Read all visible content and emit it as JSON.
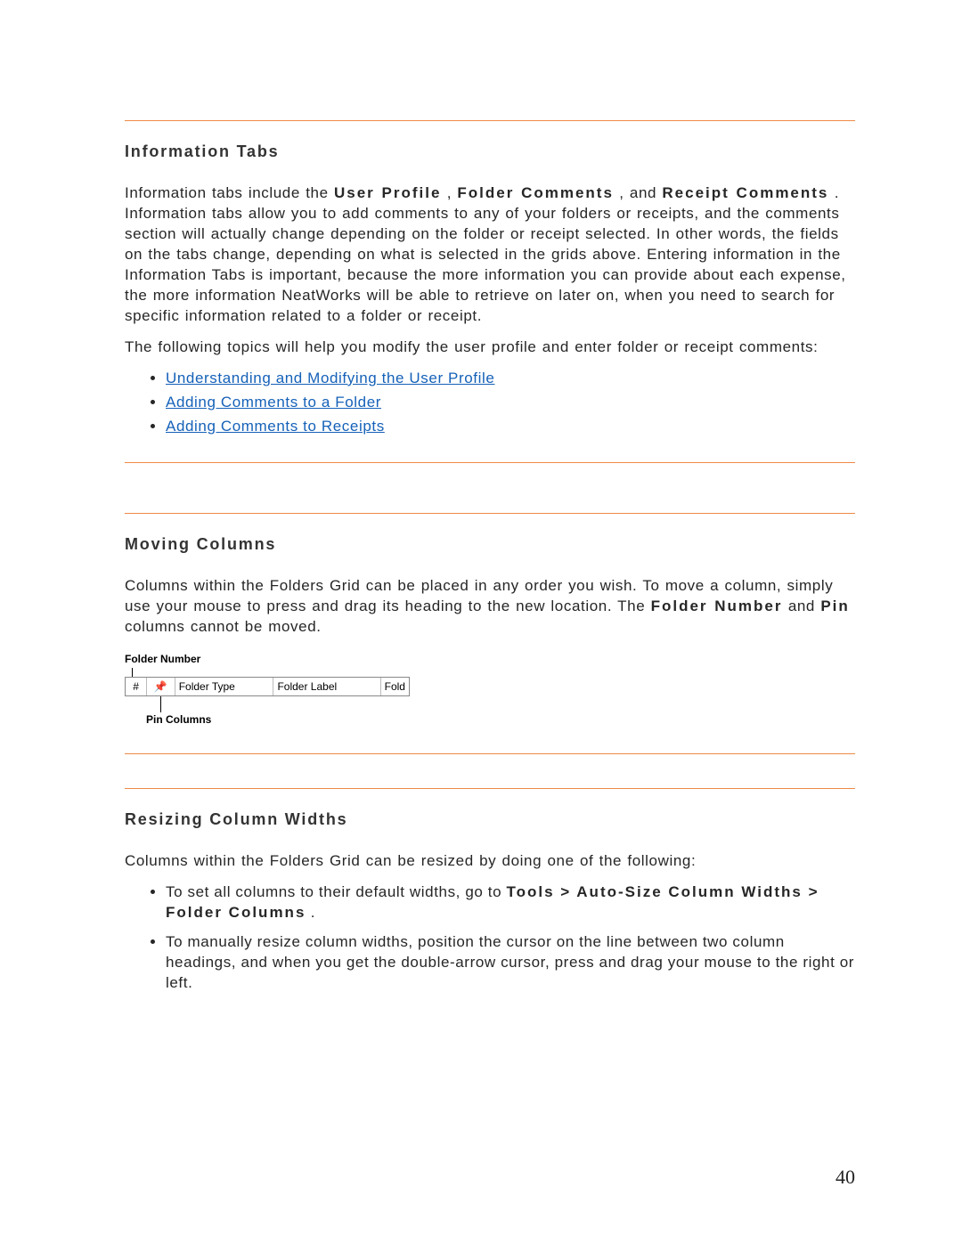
{
  "page_number": "40",
  "section1": {
    "heading": "Information Tabs",
    "para1_part1": "Information tabs include the ",
    "para1_term1": "User Profile",
    "para1_sep1": ", ",
    "para1_term2": "Folder Comments",
    "para1_sep2": ", and ",
    "para1_term3": "Receipt Comments",
    "para1_part2": ". Information tabs allow you to add comments to any of your folders or receipts, and the comments section will actually change depending on the folder or receipt selected. In other words, the fields on the tabs change, depending on what is selected in the grids above. Entering information in the Information Tabs is important, because the more information you can provide about each expense, the more information NeatWorks will be able to retrieve on later on, when you need to search for specific information related to a folder or receipt.",
    "para2": "The following topics will help you modify the user profile and enter folder or receipt comments:",
    "links": [
      "Understanding and Modifying the User Profile",
      "Adding Comments to a Folder",
      "Adding Comments to Receipts"
    ]
  },
  "section2": {
    "heading": "Moving Columns",
    "para1_part1": "Columns within the Folders Grid can be placed in any order you wish. To move a column, simply use your mouse to press and drag its heading to the new location. The ",
    "para1_term1": "Folder Number",
    "para1_mid": " and ",
    "para1_term2": "Pin",
    "para1_part2": " columns cannot be moved.",
    "figure": {
      "top_label": "Folder Number",
      "col_hash": "#",
      "col_pin_glyph": "📌",
      "col_type": "Folder Type",
      "col_label": "Folder Label",
      "col_fold": "Fold",
      "bot_label": "Pin Columns"
    }
  },
  "section3": {
    "heading": "Resizing Column Widths",
    "para1": "Columns within the Folders Grid can be resized by doing one of the following:",
    "bullets": {
      "b1_part1": "To set all columns to their default widths, go to ",
      "b1_strong": "Tools > Auto-Size Column Widths > Folder Columns",
      "b1_part2": ".",
      "b2": "To manually resize column widths, position the cursor on the line between two column headings, and when you get the double-arrow cursor, press and drag your mouse to the right or left."
    }
  }
}
